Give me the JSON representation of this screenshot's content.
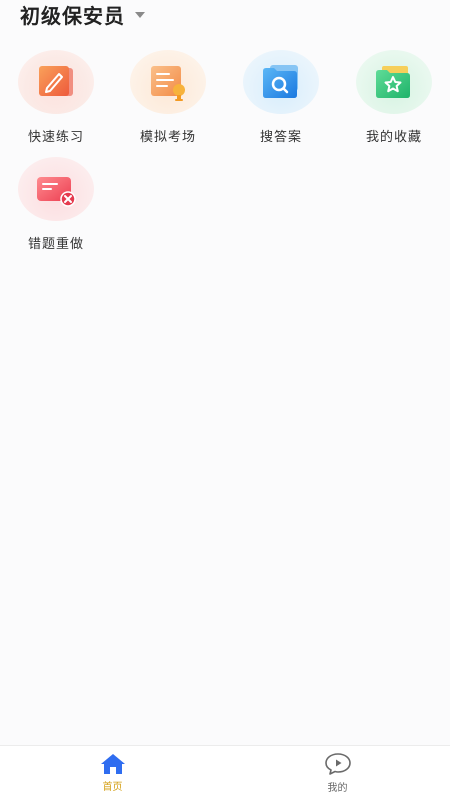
{
  "header": {
    "title": "初级保安员",
    "dropdown_icon": "caret-down-icon"
  },
  "features": [
    {
      "label": "快速练习",
      "icon": "pencil-note-icon",
      "color": "#f47a4b"
    },
    {
      "label": "模拟考场",
      "icon": "exam-trophy-icon",
      "color": "#f5a05a"
    },
    {
      "label": "搜答案",
      "icon": "search-folder-icon",
      "color": "#2d8ee8"
    },
    {
      "label": "我的收藏",
      "icon": "star-folder-icon",
      "color": "#2ec477"
    },
    {
      "label": "错题重做",
      "icon": "wrong-card-icon",
      "color": "#ef4b5a"
    }
  ],
  "tabbar": {
    "tabs": [
      {
        "label": "首页",
        "icon": "home-icon",
        "active": true
      },
      {
        "label": "我的",
        "icon": "chat-play-icon",
        "active": false
      }
    ],
    "active_color": "#d4a017",
    "home_icon_color": "#2f6df0"
  }
}
